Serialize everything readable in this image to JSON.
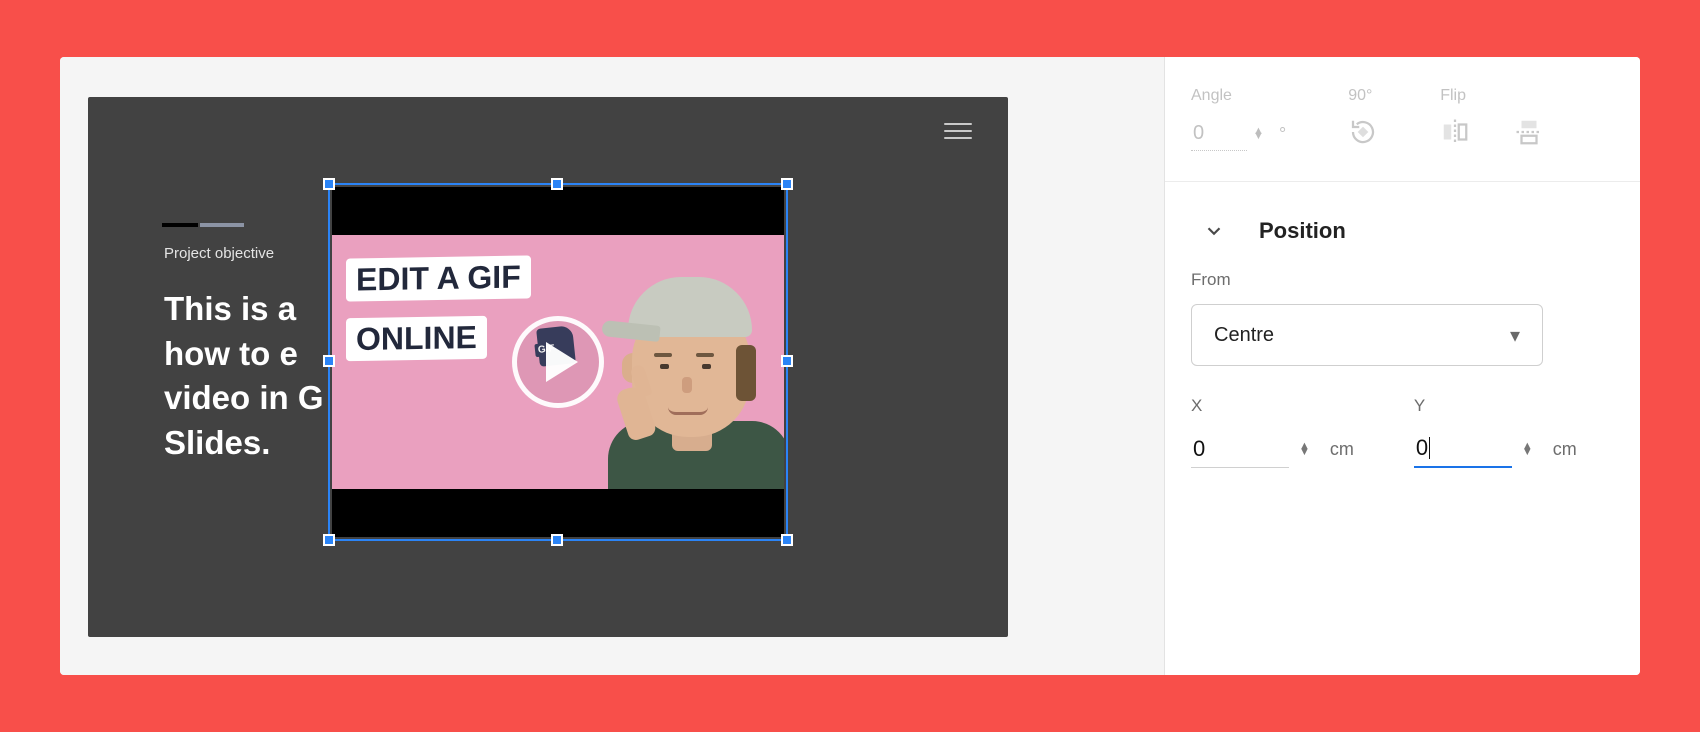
{
  "slide": {
    "subheading": "Project objective",
    "title": "This is a\nhow to e\nvideo in G\nSlides.",
    "video": {
      "text1": "EDIT A GIF",
      "text2": "ONLINE",
      "badge": "GIF"
    }
  },
  "sidebar": {
    "angle": {
      "label": "Angle",
      "value": "0",
      "degree": "°"
    },
    "ninety": {
      "label": "90°"
    },
    "flip": {
      "label": "Flip"
    },
    "position": {
      "header": "Position",
      "from_label": "From",
      "from_value": "Centre",
      "x": {
        "label": "X",
        "value": "0",
        "unit": "cm"
      },
      "y": {
        "label": "Y",
        "value": "0",
        "unit": "cm"
      }
    }
  }
}
